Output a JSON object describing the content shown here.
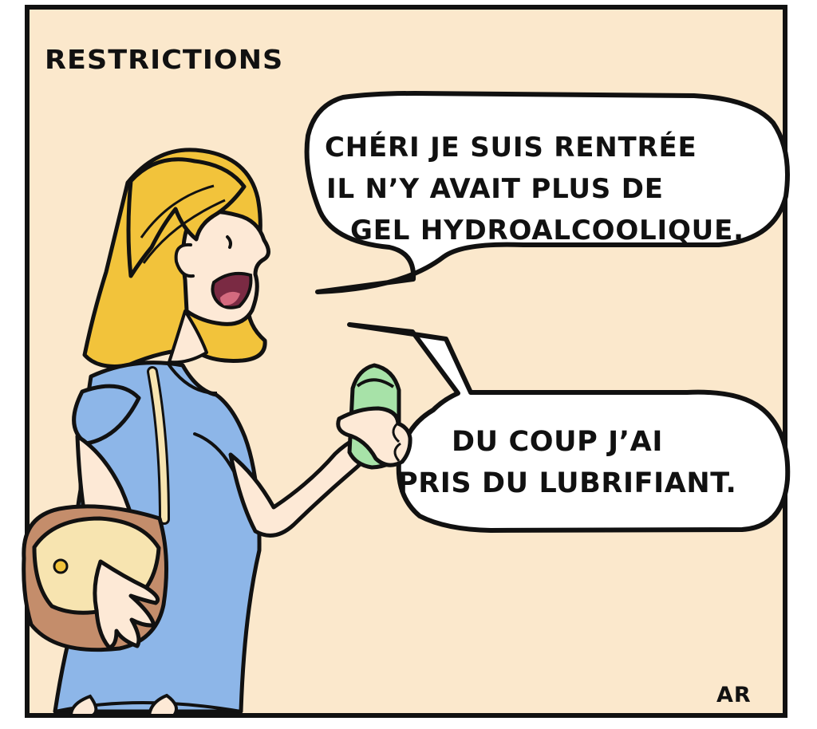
{
  "title": "RESTRICTIONS",
  "bubble_1": {
    "lines": [
      "CHÉRI JE SUIS RENTRÉE",
      "IL N’Y AVAIT PLUS DE",
      "GEL HYDROALCOOLIQUE."
    ]
  },
  "bubble_2": {
    "lines": [
      "DU COUP J’AI",
      "PRIS DU LUBRIFIANT."
    ]
  },
  "signature": "AR",
  "colors": {
    "background": "#fbe8cc",
    "outline": "#111111",
    "hair": "#f2c33b",
    "dress": "#8db6e8",
    "skin": "#fde9d6",
    "bag": "#c48d6b",
    "bag_flap": "#f7e4b0",
    "bottle": "#a7e2a8",
    "speech_bubble": "#ffffff",
    "mouth": "#7a2a43"
  }
}
